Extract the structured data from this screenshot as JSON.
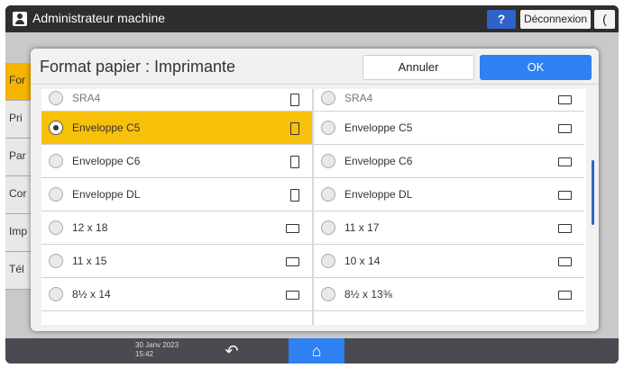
{
  "topbar": {
    "title": "Administrateur machine",
    "help_label": "?",
    "logout_label": "Déconnexion",
    "back_label": "("
  },
  "background_tabs": [
    "For",
    "Pri",
    "Par",
    "Cor",
    "Imp",
    "Tél"
  ],
  "dialog": {
    "title": "Format papier : Imprimante",
    "cancel_label": "Annuler",
    "ok_label": "OK"
  },
  "paper_list": {
    "left": [
      {
        "label": "SRA4",
        "selected": false,
        "orientation": "portrait"
      },
      {
        "label": "Enveloppe C5",
        "selected": true,
        "orientation": "portrait"
      },
      {
        "label": "Enveloppe C6",
        "selected": false,
        "orientation": "portrait"
      },
      {
        "label": "Enveloppe DL",
        "selected": false,
        "orientation": "portrait"
      },
      {
        "label": "12 x 18",
        "selected": false,
        "orientation": "landscape"
      },
      {
        "label": "11 x 15",
        "selected": false,
        "orientation": "landscape"
      },
      {
        "label": "8½ x 14",
        "selected": false,
        "orientation": "landscape"
      }
    ],
    "right": [
      {
        "label": "SRA4",
        "selected": false,
        "orientation": "landscape"
      },
      {
        "label": "Enveloppe C5",
        "selected": false,
        "orientation": "landscape"
      },
      {
        "label": "Enveloppe C6",
        "selected": false,
        "orientation": "landscape"
      },
      {
        "label": "Enveloppe DL",
        "selected": false,
        "orientation": "landscape"
      },
      {
        "label": "11 x 17",
        "selected": false,
        "orientation": "landscape"
      },
      {
        "label": "10 x 14",
        "selected": false,
        "orientation": "landscape"
      },
      {
        "label": "8½ x 13⅜",
        "selected": false,
        "orientation": "landscape"
      }
    ]
  },
  "bottombar": {
    "date": "30 Janv 2023",
    "time": "15:42",
    "back_icon": "↶",
    "home_icon": "⌂"
  },
  "colors": {
    "selected_row": "#f6c108",
    "ok_button": "#2f80f0",
    "help_button": "#2f63c8"
  }
}
